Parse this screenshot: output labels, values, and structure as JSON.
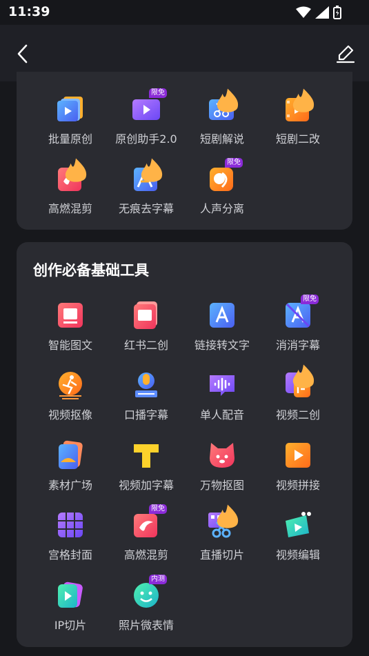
{
  "status": {
    "time": "11:39"
  },
  "colors": {
    "background": "#17181c",
    "card": "#2a2b31",
    "badge": "#8b2bd8",
    "accent": "#fdd22b"
  },
  "section1": {
    "tools": [
      {
        "label": "批量原创",
        "icon": "batch-original-icon"
      },
      {
        "label": "原创助手2.0",
        "icon": "original-assistant-icon",
        "badge": "限免"
      },
      {
        "label": "短剧解说",
        "icon": "drama-commentary-icon",
        "flame": true
      },
      {
        "label": "短剧二改",
        "icon": "drama-remix-icon",
        "flame": true
      },
      {
        "label": "高燃混剪",
        "icon": "highlight-mix-icon",
        "flame": true
      },
      {
        "label": "无痕去字幕",
        "icon": "remove-subtitle-icon",
        "flame": true
      },
      {
        "label": "人声分离",
        "icon": "vocal-separation-icon",
        "badge": "限免"
      }
    ]
  },
  "section2": {
    "title": "创作必备基础工具",
    "tools": [
      {
        "label": "智能图文",
        "icon": "smart-image-text-icon"
      },
      {
        "label": "红书二创",
        "icon": "redbook-remix-icon"
      },
      {
        "label": "链接转文字",
        "icon": "link-to-text-icon"
      },
      {
        "label": "消消字幕",
        "icon": "erase-subtitle-icon",
        "badge": "限免"
      },
      {
        "label": "视频抠像",
        "icon": "video-cutout-icon"
      },
      {
        "label": "口播字幕",
        "icon": "voice-subtitle-icon"
      },
      {
        "label": "单人配音",
        "icon": "single-dubbing-icon"
      },
      {
        "label": "视频二创",
        "icon": "video-remix-icon",
        "flame": true
      },
      {
        "label": "素材广场",
        "icon": "material-square-icon"
      },
      {
        "label": "视频加字幕",
        "icon": "video-add-subtitle-icon"
      },
      {
        "label": "万物抠图",
        "icon": "object-cutout-icon"
      },
      {
        "label": "视频拼接",
        "icon": "video-splice-icon"
      },
      {
        "label": "宫格封面",
        "icon": "grid-cover-icon"
      },
      {
        "label": "高燃混剪",
        "icon": "highlight-mix-icon",
        "badge": "限免"
      },
      {
        "label": "直播切片",
        "icon": "live-clip-icon",
        "flame": true
      },
      {
        "label": "视频编辑",
        "icon": "video-edit-icon"
      },
      {
        "label": "IP切片",
        "icon": "ip-clip-icon"
      },
      {
        "label": "照片微表情",
        "icon": "photo-micro-expression-icon",
        "badge": "内测"
      }
    ]
  }
}
